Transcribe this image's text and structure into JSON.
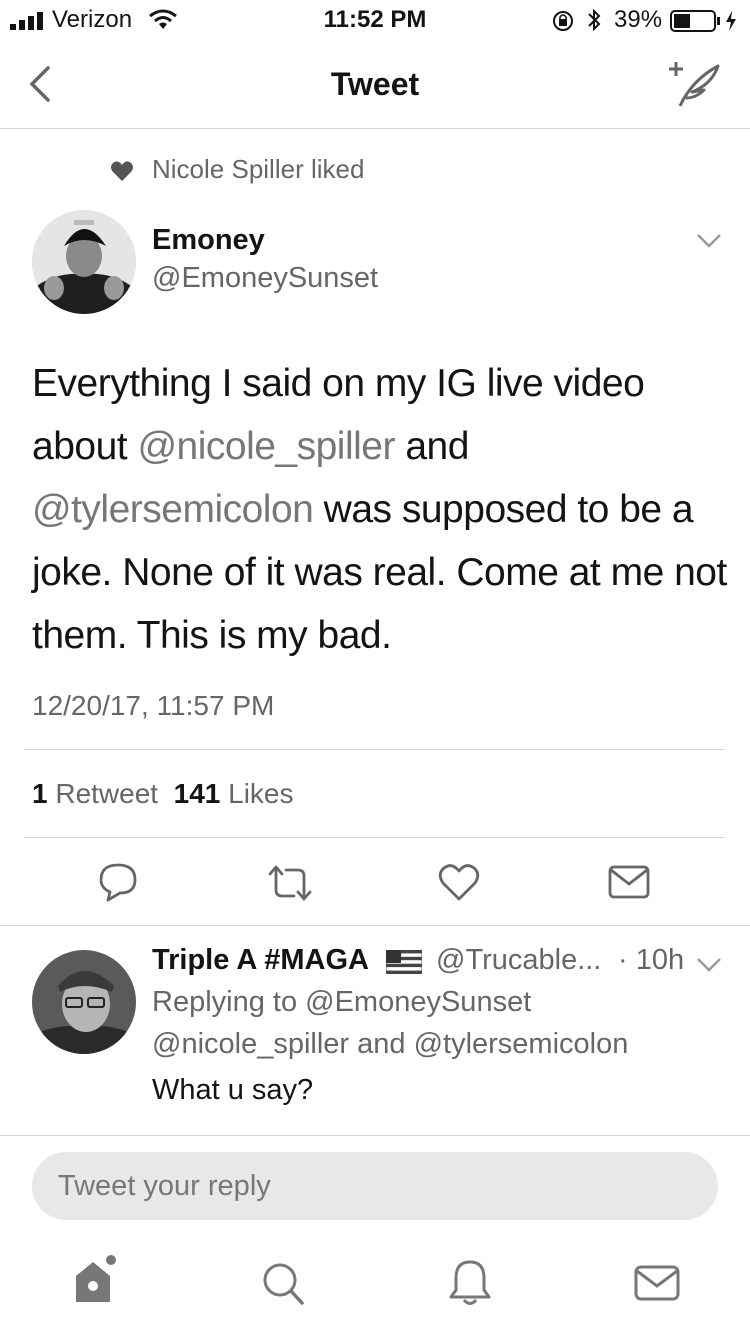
{
  "status_bar": {
    "carrier": "Verizon",
    "time": "11:52 PM",
    "battery_percent": "39%"
  },
  "nav": {
    "title": "Tweet"
  },
  "social_context": {
    "text": "Nicole Spiller liked"
  },
  "tweet": {
    "author_name": "Emoney",
    "author_handle": "@EmoneySunset",
    "text_parts": [
      "Everything I said on my IG live video about ",
      "@nicole_spiller",
      " and ",
      "@tylersemicolon",
      " was supposed to be a joke. None of it was real. Come at me not them. This is my bad."
    ],
    "timestamp": "12/20/17, 11:57 PM",
    "retweet_count": "1",
    "retweet_label": "Retweet",
    "like_count": "141",
    "like_label": "Likes"
  },
  "reply": {
    "author_name": "Triple A #MAGA",
    "author_handle": "@Trucable...",
    "time": "· 10h",
    "replying_to_line1": "Replying to @EmoneySunset",
    "replying_to_line2": "@nicole_spiller and @tylersemicolon",
    "text": "What u say?"
  },
  "compose": {
    "placeholder": "Tweet your reply"
  },
  "icons": {
    "back": "chevron-left-icon",
    "compose": "compose-feather-icon",
    "heart_small": "heart-icon",
    "more": "chevron-down-icon",
    "reply": "reply-icon",
    "retweet": "retweet-icon",
    "like": "like-icon",
    "dm": "envelope-icon",
    "tab_home": "home-icon",
    "tab_search": "search-icon",
    "tab_notifications": "bell-icon",
    "tab_messages": "messages-icon",
    "flag": "us-flag-icon"
  }
}
